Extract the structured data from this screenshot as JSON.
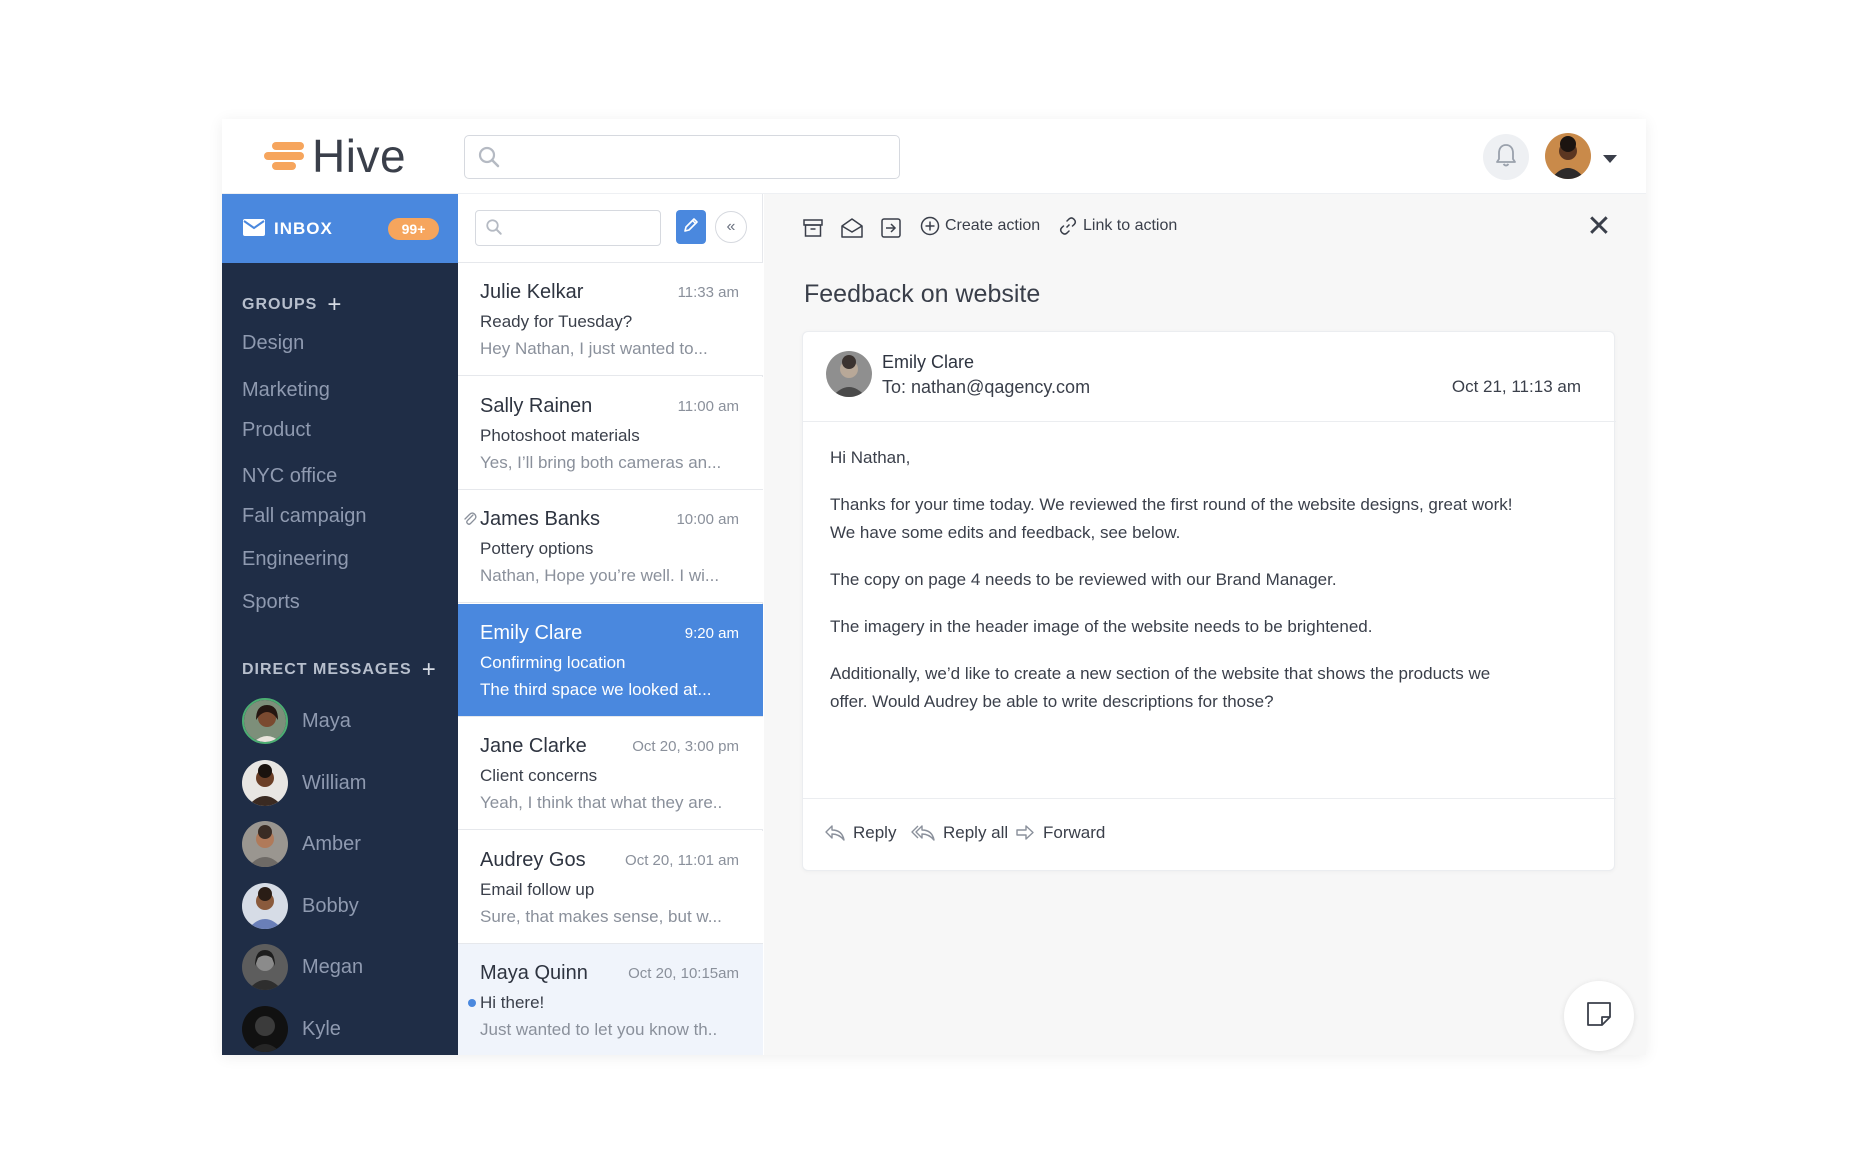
{
  "app": {
    "name": "Hive"
  },
  "header": {
    "search_placeholder": ""
  },
  "colors": {
    "accent": "#4a88de",
    "brand": "#f6a55d",
    "sidebar": "#1f2d46"
  },
  "sidebar": {
    "inbox_label": "INBOX",
    "inbox_badge": "99+",
    "groups_title": "GROUPS",
    "groups": [
      "Design",
      "Marketing",
      "Product",
      "NYC office",
      "Fall campaign",
      "Engineering",
      "Sports"
    ],
    "dm_title": "DIRECT MESSAGES",
    "direct_messages": [
      "Maya",
      "William",
      "Amber",
      "Bobby",
      "Megan",
      "Kyle"
    ]
  },
  "message_list": {
    "search_placeholder": "",
    "collapse_label": "«",
    "messages": [
      {
        "sender": "Julie Kelkar",
        "time": "11:33 am",
        "subject": "Ready for Tuesday?",
        "preview": "Hey Nathan, I just wanted to..."
      },
      {
        "sender": "Sally Rainen",
        "time": "11:00 am",
        "subject": "Photoshoot materials",
        "preview": "Yes, I’ll bring both cameras an..."
      },
      {
        "sender": "James Banks",
        "time": "10:00 am",
        "subject": "Pottery options",
        "preview": "Nathan, Hope you’re well. I wi...",
        "attachment": true
      },
      {
        "sender": "Emily Clare",
        "time": "9:20 am",
        "subject": "Confirming location",
        "preview": "The third space we looked at...",
        "selected": true
      },
      {
        "sender": "Jane Clarke",
        "time": "Oct 20, 3:00 pm",
        "subject": "Client concerns",
        "preview": "Yeah, I think that what they are.."
      },
      {
        "sender": "Audrey Gos",
        "time": "Oct 20, 11:01 am",
        "subject": "Email follow up",
        "preview": "Sure, that makes sense, but w..."
      },
      {
        "sender": "Maya Quinn",
        "time": "Oct 20, 10:15am",
        "subject": "Hi there!",
        "preview": "Just wanted to let you know th..",
        "unread": true
      }
    ]
  },
  "reader": {
    "toolbar": {
      "create_action": "Create action",
      "link_action": "Link to action",
      "close": "✕"
    },
    "title": "Feedback on website",
    "from_name": "Emily Clare",
    "to_line": "To: nathan@qagency.com",
    "date": "Oct 21, 11:13 am",
    "body": {
      "greeting": "Hi Nathan,",
      "p1_line1": "Thanks for your time today. We reviewed the first round of the website designs, great work!",
      "p1_line2": "We have some edits and feedback, see below.",
      "p2": "The copy on page 4 needs to be reviewed with our Brand Manager.",
      "p3": "The imagery in the header image of the website needs to be brightened.",
      "p4_line1": "Additionally, we’d like to create a new section of the website that shows the products we",
      "p4_line2": "offer. Would Audrey be able to write descriptions for those?"
    },
    "actions": {
      "reply": "Reply",
      "reply_all": "Reply all",
      "forward": "Forward"
    }
  }
}
